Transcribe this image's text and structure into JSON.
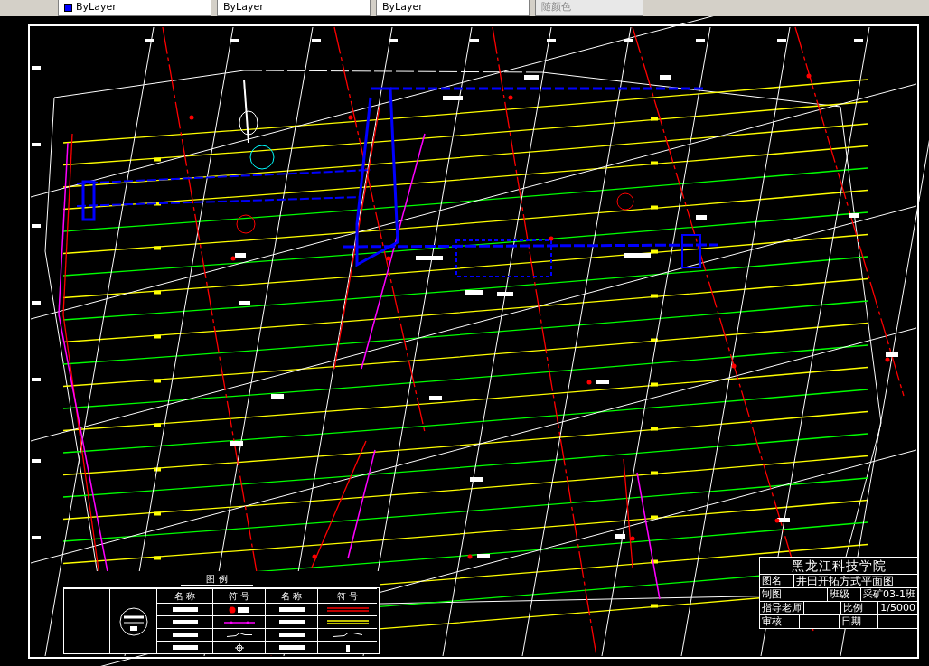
{
  "toolbar": {
    "dropdowns": [
      {
        "kind": "layer",
        "label": "ByLayer"
      },
      {
        "kind": "plain",
        "label": "ByLayer"
      },
      {
        "kind": "plain",
        "label": "ByLayer"
      },
      {
        "kind": "field",
        "label": "随颜色"
      }
    ]
  },
  "legend": {
    "title": "图 例",
    "headers": [
      "名 称",
      "符 号",
      "名 称",
      "符 号"
    ]
  },
  "title_block": {
    "school": "黑龙江科技学院",
    "name_label": "图名",
    "name": "井田开拓方式平面图",
    "rows": [
      {
        "label": "制图",
        "field": "班级",
        "value": "采矿03-1班"
      },
      {
        "label": "指导老师",
        "field": "比例",
        "value": "1/5000"
      },
      {
        "label": "审核",
        "field": "日期"
      }
    ]
  }
}
